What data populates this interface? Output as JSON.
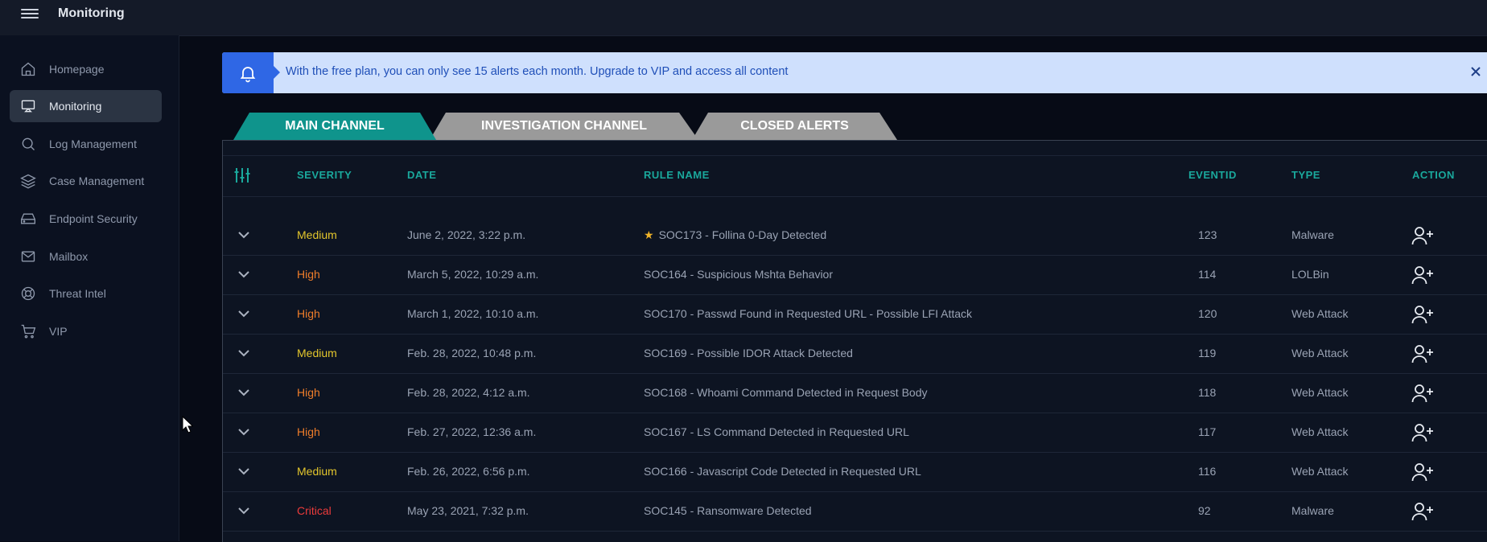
{
  "app": {
    "title": "Monitoring"
  },
  "sidebar": {
    "items": [
      {
        "label": "Homepage",
        "icon": "home-icon"
      },
      {
        "label": "Monitoring",
        "icon": "monitor-icon",
        "active": true
      },
      {
        "label": "Log Management",
        "icon": "search-icon"
      },
      {
        "label": "Case Management",
        "icon": "layers-icon"
      },
      {
        "label": "Endpoint Security",
        "icon": "hard-drive-icon"
      },
      {
        "label": "Mailbox",
        "icon": "mail-icon"
      },
      {
        "label": "Threat Intel",
        "icon": "lifebuoy-icon"
      },
      {
        "label": "VIP",
        "icon": "cart-icon"
      }
    ]
  },
  "banner": {
    "text": "With the free plan, you can only see 15 alerts each month. Upgrade to VIP and access all content",
    "icon": "bell-icon",
    "close_icon": "close-icon"
  },
  "tabs": [
    {
      "label": "MAIN CHANNEL",
      "active": true
    },
    {
      "label": "INVESTIGATION CHANNEL"
    },
    {
      "label": "CLOSED ALERTS"
    }
  ],
  "table": {
    "headers": {
      "severity": "SEVERITY",
      "date": "DATE",
      "rule": "RULE NAME",
      "eventid": "EVENTID",
      "type": "TYPE",
      "action": "ACTION"
    },
    "rows": [
      {
        "severity": "Medium",
        "date": "June 2, 2022, 3:22 p.m.",
        "rule": "SOC173 - Follina 0-Day Detected",
        "starred": true,
        "eventid": "123",
        "type": "Malware"
      },
      {
        "severity": "High",
        "date": "March 5, 2022, 10:29 a.m.",
        "rule": "SOC164 - Suspicious Mshta Behavior",
        "eventid": "114",
        "type": "LOLBin"
      },
      {
        "severity": "High",
        "date": "March 1, 2022, 10:10 a.m.",
        "rule": "SOC170 - Passwd Found in Requested URL - Possible LFI Attack",
        "eventid": "120",
        "type": "Web Attack"
      },
      {
        "severity": "Medium",
        "date": "Feb. 28, 2022, 10:48 p.m.",
        "rule": "SOC169 - Possible IDOR Attack Detected",
        "eventid": "119",
        "type": "Web Attack"
      },
      {
        "severity": "High",
        "date": "Feb. 28, 2022, 4:12 a.m.",
        "rule": "SOC168 - Whoami Command Detected in Request Body",
        "eventid": "118",
        "type": "Web Attack"
      },
      {
        "severity": "High",
        "date": "Feb. 27, 2022, 12:36 a.m.",
        "rule": "SOC167 - LS Command Detected in Requested URL",
        "eventid": "117",
        "type": "Web Attack"
      },
      {
        "severity": "Medium",
        "date": "Feb. 26, 2022, 6:56 p.m.",
        "rule": "SOC166 - Javascript Code Detected in Requested URL",
        "eventid": "116",
        "type": "Web Attack"
      },
      {
        "severity": "Critical",
        "date": "May 23, 2021, 7:32 p.m.",
        "rule": "SOC145 - Ransomware Detected",
        "eventid": "92",
        "type": "Malware"
      }
    ]
  },
  "colors": {
    "accent": "#1aa89c",
    "medium": "#e3c62c",
    "high": "#ef7d2a",
    "critical": "#ec3b3b",
    "banner_bg": "#cfe0fd",
    "banner_icon_bg": "#2f67e5"
  }
}
